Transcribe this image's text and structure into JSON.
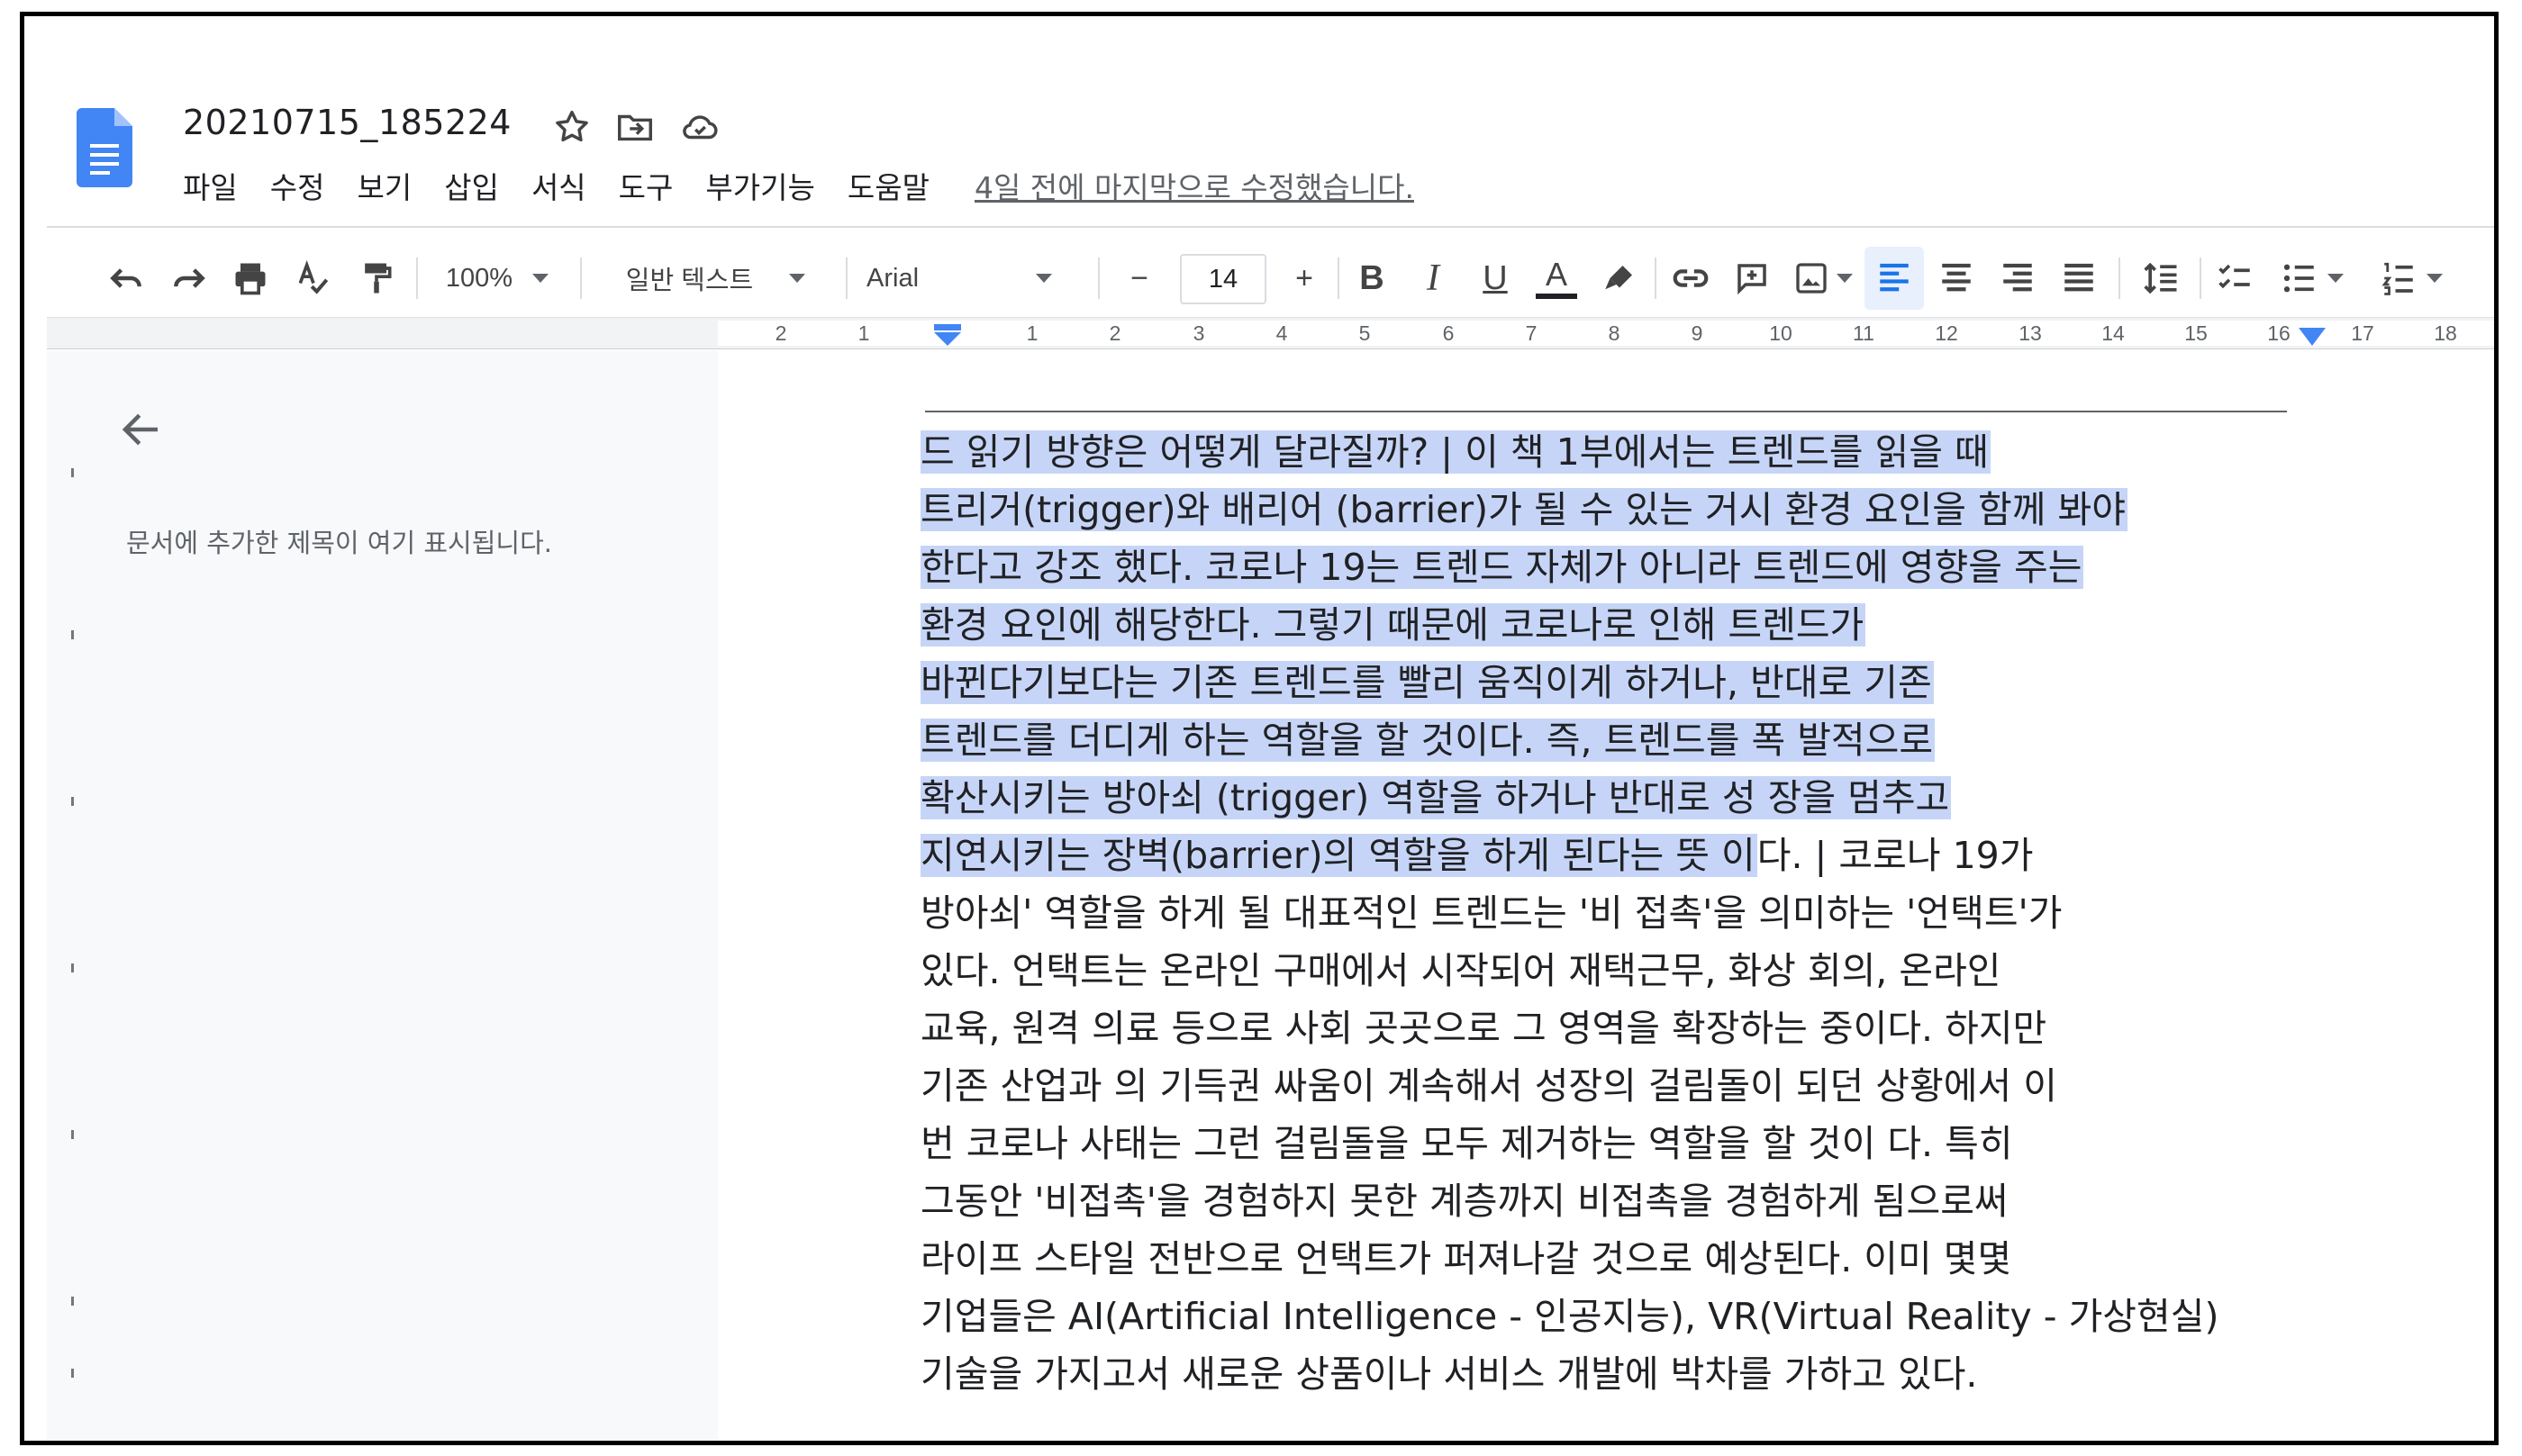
{
  "document": {
    "title": "20210715_185224"
  },
  "menu": {
    "items": [
      "파일",
      "수정",
      "보기",
      "삽입",
      "서식",
      "도구",
      "부가기능",
      "도움말"
    ],
    "last_edit": "4일 전에 마지막으로 수정했습니다."
  },
  "toolbar": {
    "zoom": "100%",
    "style": "일반 텍스트",
    "font": "Arial",
    "font_size": "14",
    "minus": "−",
    "plus": "+",
    "bold": "B",
    "italic": "I",
    "underline": "U",
    "text_color": "A",
    "icons": [
      "undo-icon",
      "redo-icon",
      "print-icon",
      "spellcheck-icon",
      "paint-format-icon",
      "bold-icon",
      "italic-icon",
      "underline-icon",
      "text-color-icon",
      "highlight-icon",
      "link-icon",
      "comment-icon",
      "image-icon",
      "align-left-icon",
      "align-center-icon",
      "align-right-icon",
      "align-justify-icon",
      "line-spacing-icon",
      "checklist-icon",
      "bulleted-list-icon",
      "numbered-list-icon"
    ]
  },
  "ruler": {
    "labels": [
      "2",
      "1",
      "1",
      "2",
      "3",
      "4",
      "5",
      "6",
      "7",
      "8",
      "9",
      "10",
      "11",
      "12",
      "13",
      "14",
      "15",
      "16",
      "17",
      "18"
    ]
  },
  "outline": {
    "message": "문서에 추가한 제목이 여기 표시됩니다."
  },
  "body": {
    "highlight_color": "#c6d5f7",
    "lines": [
      {
        "highlighted": "드 읽기 방향은 어떻게 달라질까? | 이 책 1부에서는 트렌드를 읽을 때",
        "rest": ""
      },
      {
        "highlighted": "트리거(trigger)와 배리어 (barrier)가 될 수 있는 거시 환경 요인을 함께 봐야",
        "rest": ""
      },
      {
        "highlighted": "한다고 강조 했다. 코로나 19는 트렌드 자체가 아니라 트렌드에 영향을 주는",
        "rest": ""
      },
      {
        "highlighted": "환경 요인에 해당한다. 그렇기 때문에 코로나로 인해 트렌드가",
        "rest": ""
      },
      {
        "highlighted": "바뀐다기보다는 기존 트렌드를 빨리 움직이게 하거나, 반대로 기존",
        "rest": ""
      },
      {
        "highlighted": "트렌드를 더디게 하는 역할을 할 것이다. 즉, 트렌드를 폭 발적으로",
        "rest": ""
      },
      {
        "highlighted": "확산시키는 방아쇠 (trigger) 역할을 하거나 반대로 성 장을 멈추고",
        "rest": ""
      },
      {
        "highlighted": "지연시키는 장벽(barrier)의 역할을 하게 된다는 뜻 이",
        "rest": "다. | 코로나 19가"
      },
      {
        "highlighted": "",
        "rest": "방아쇠' 역할을 하게 될 대표적인 트렌드는 '비 접촉'을 의미하는 '언택트'가"
      },
      {
        "highlighted": "",
        "rest": "있다. 언택트는 온라인 구매에서 시작되어 재택근무, 화상 회의, 온라인"
      },
      {
        "highlighted": "",
        "rest": "교육, 원격 의료 등으로 사회 곳곳으로 그 영역을 확장하는 중이다. 하지만"
      },
      {
        "highlighted": "",
        "rest": "기존 산업과 의 기득권 싸움이 계속해서 성장의 걸림돌이 되던 상황에서 이"
      },
      {
        "highlighted": "",
        "rest": "번 코로나 사태는 그런 걸림돌을 모두 제거하는 역할을 할 것이 다. 특히"
      },
      {
        "highlighted": "",
        "rest": "그동안 '비접촉'을 경험하지 못한 계층까지 비접촉을 경험하게 됨으로써"
      },
      {
        "highlighted": "",
        "rest": "라이프 스타일 전반으로 언택트가 퍼져나갈 것으로 예상된다. 이미 몇몇"
      },
      {
        "highlighted": "",
        "rest": "기업들은 AI(Artificial Intelligence - 인공지능), VR(Virtual Reality - 가상현실)"
      },
      {
        "highlighted": "",
        "rest": "기술을 가지고서 새로운 상품이나 서비스 개발에 박차를 가하고 있다."
      }
    ]
  },
  "colors": {
    "docs_blue": "#4285f4",
    "selection": "#c6d5f7",
    "active_button_bg": "#e8f0fe"
  }
}
